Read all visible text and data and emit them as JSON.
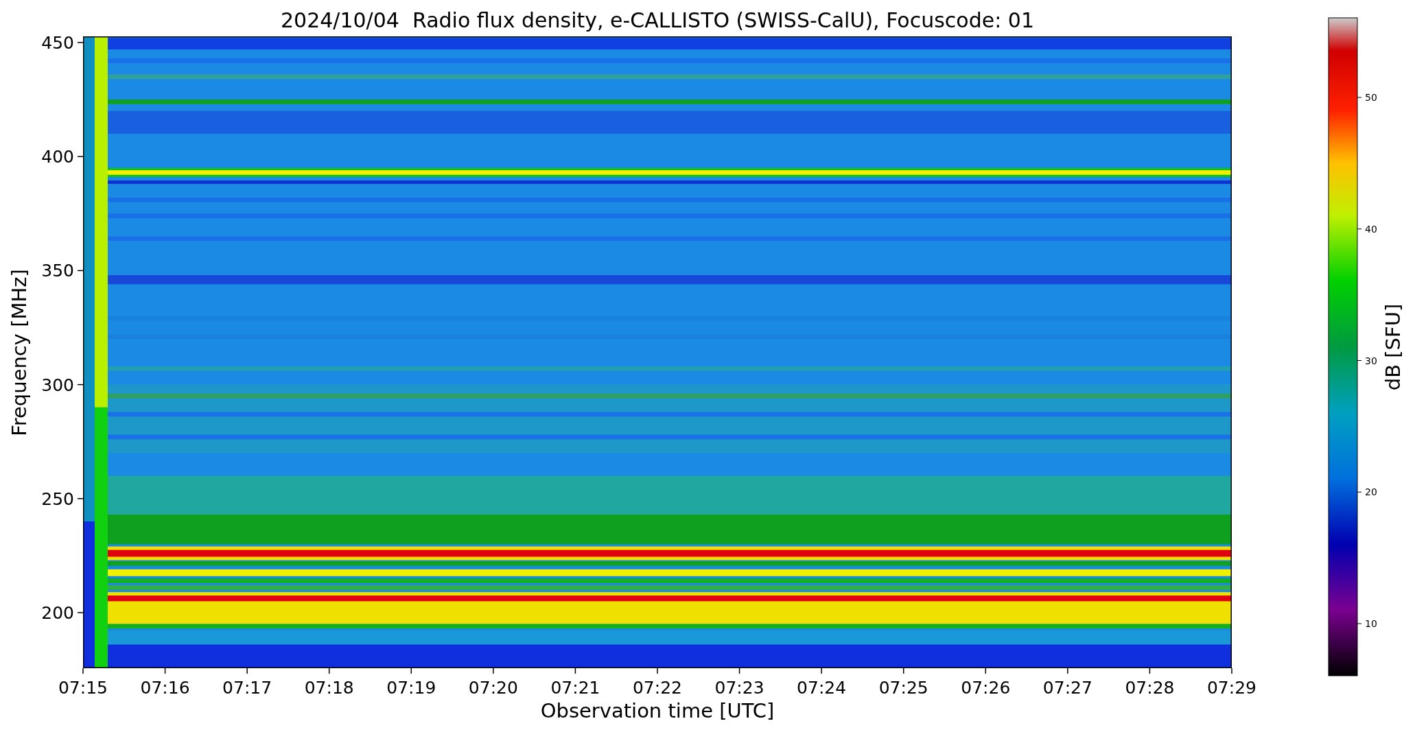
{
  "plot": {
    "title": "2024/10/04  Radio flux density, e-CALLISTO (SWISS-CalU), Focuscode: 01",
    "y_axis": {
      "label": "Frequency [MHz]",
      "ticks": [
        "450",
        "400",
        "350",
        "300",
        "250",
        "200"
      ]
    },
    "x_axis": {
      "label": "Observation time [UTC]",
      "ticks": [
        "07:15",
        "07:16",
        "07:17",
        "07:18",
        "07:19",
        "07:20",
        "07:21",
        "07:22",
        "07:23",
        "07:24",
        "07:25",
        "07:26",
        "07:27",
        "07:28",
        "07:29"
      ]
    }
  },
  "colorbar": {
    "label": "dB [SFU]",
    "ticks": [
      "50",
      "40",
      "30",
      "20",
      "10"
    ]
  }
}
